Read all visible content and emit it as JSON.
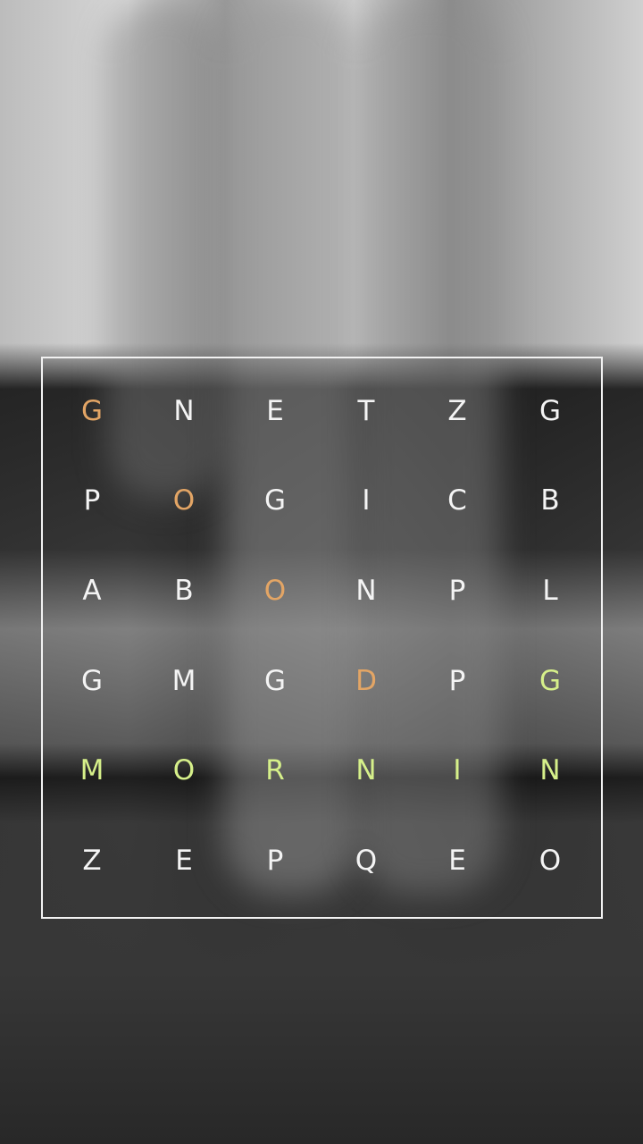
{
  "puzzle": {
    "rows": [
      [
        "G",
        "N",
        "E",
        "T",
        "Z",
        "G"
      ],
      [
        "P",
        "O",
        "G",
        "I",
        "C",
        "B"
      ],
      [
        "A",
        "B",
        "O",
        "N",
        "P",
        "L"
      ],
      [
        "G",
        "M",
        "G",
        "D",
        "P",
        "G"
      ],
      [
        "M",
        "O",
        "R",
        "N",
        "I",
        "N"
      ],
      [
        "Z",
        "E",
        "P",
        "Q",
        "E",
        "O"
      ]
    ],
    "highlights": [
      {
        "word": "GOOD",
        "color": "#e3a565",
        "cells": [
          [
            0,
            0
          ],
          [
            1,
            1
          ],
          [
            2,
            2
          ],
          [
            3,
            3
          ]
        ]
      },
      {
        "word": "MORNING",
        "color": "#d6f08a",
        "cells": [
          [
            4,
            0
          ],
          [
            4,
            1
          ],
          [
            4,
            2
          ],
          [
            4,
            3
          ],
          [
            4,
            4
          ],
          [
            4,
            5
          ],
          [
            3,
            5
          ]
        ]
      }
    ]
  }
}
